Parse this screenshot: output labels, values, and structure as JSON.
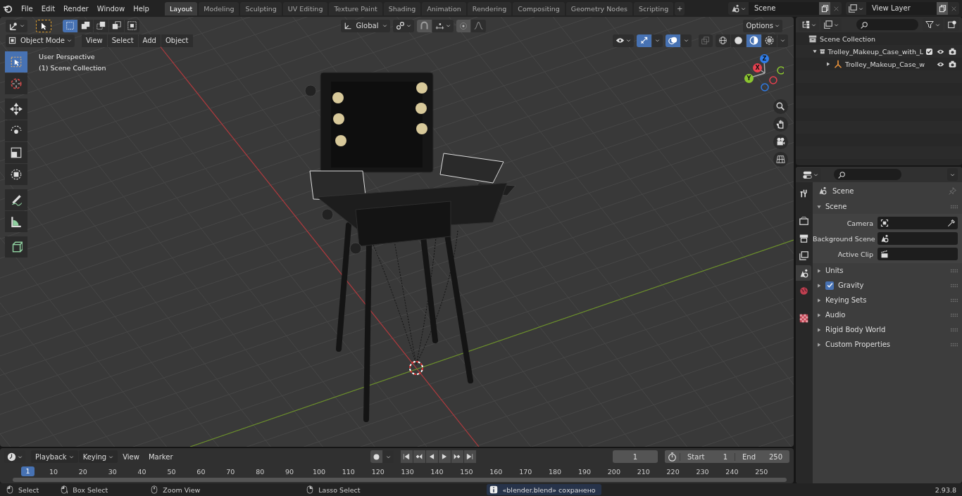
{
  "top_bar": {
    "menus": [
      "File",
      "Edit",
      "Render",
      "Window",
      "Help"
    ],
    "workspaces": [
      {
        "label": "Layout",
        "selected": true
      },
      {
        "label": "Modeling",
        "selected": false
      },
      {
        "label": "Sculpting",
        "selected": false
      },
      {
        "label": "UV Editing",
        "selected": false
      },
      {
        "label": "Texture Paint",
        "selected": false
      },
      {
        "label": "Shading",
        "selected": false
      },
      {
        "label": "Animation",
        "selected": false
      },
      {
        "label": "Rendering",
        "selected": false
      },
      {
        "label": "Compositing",
        "selected": false
      },
      {
        "label": "Geometry Nodes",
        "selected": false
      },
      {
        "label": "Scripting",
        "selected": false
      }
    ],
    "add_tab": "+",
    "scene": "Scene",
    "view_layer": "View Layer"
  },
  "viewport": {
    "select_modes": [
      {
        "kind": "set",
        "selected": true
      },
      {
        "kind": "extend",
        "selected": false
      },
      {
        "kind": "subtract",
        "selected": false
      },
      {
        "kind": "invert",
        "selected": false
      },
      {
        "kind": "intersect",
        "selected": false
      }
    ],
    "orientation": "Global",
    "options": "Options",
    "mode": "Object Mode",
    "menus": [
      "View",
      "Select",
      "Add",
      "Object"
    ],
    "gizmos_on": true,
    "overlays_on": true,
    "shading": [
      {
        "kind": "wireframe",
        "selected": false
      },
      {
        "kind": "solid",
        "selected": false
      },
      {
        "kind": "material",
        "selected": true
      },
      {
        "kind": "rendered",
        "selected": false
      }
    ],
    "overlay_text": [
      "User Perspective",
      "(1) Scene Collection"
    ],
    "axes": [
      {
        "kind": "z",
        "label": "Z"
      },
      {
        "kind": "x",
        "label": "X"
      },
      {
        "kind": "y",
        "label": "Y"
      }
    ],
    "tools": [
      {
        "kind": "select",
        "selected": true
      },
      {
        "kind": "cursor",
        "selected": false
      },
      {
        "kind": "move",
        "selected": false
      },
      {
        "kind": "rotate",
        "selected": false
      },
      {
        "kind": "scale",
        "selected": false
      },
      {
        "kind": "transform",
        "selected": false
      },
      {
        "kind": "annotate",
        "selected": false
      },
      {
        "kind": "measure",
        "selected": false
      },
      {
        "kind": "add",
        "selected": false
      }
    ]
  },
  "outliner": {
    "root": "Scene Collection",
    "items": [
      {
        "label": "Trolley_Makeup_Case_with_L",
        "kind": "collection",
        "expanded": true,
        "checked": true,
        "children": [
          {
            "label": "Trolley_Makeup_Case_w",
            "kind": "empty",
            "expanded": false
          }
        ]
      }
    ]
  },
  "properties": {
    "tabs": [
      {
        "kind": "tool",
        "selected": false
      },
      {
        "kind": "render",
        "selected": false
      },
      {
        "kind": "output",
        "selected": false
      },
      {
        "kind": "view_layer",
        "selected": false
      },
      {
        "kind": "scene",
        "selected": true
      },
      {
        "kind": "world",
        "selected": false
      },
      {
        "kind": "texture",
        "selected": false
      }
    ],
    "context": "Scene",
    "panels": [
      {
        "label": "Scene",
        "expanded": true,
        "fields": [
          {
            "label": "Camera",
            "kind": "camera"
          },
          {
            "label": "Background Scene",
            "kind": "scene"
          },
          {
            "label": "Active Clip",
            "kind": "clip"
          }
        ]
      },
      {
        "label": "Units",
        "expanded": false
      },
      {
        "label": "Gravity",
        "expanded": false,
        "checked": true
      },
      {
        "label": "Keying Sets",
        "expanded": false
      },
      {
        "label": "Audio",
        "expanded": false
      },
      {
        "label": "Rigid Body World",
        "expanded": false
      },
      {
        "label": "Custom Properties",
        "expanded": false
      }
    ]
  },
  "timeline": {
    "menus": [
      {
        "label": "Playback",
        "dropdown": true
      },
      {
        "label": "Keying",
        "dropdown": true
      },
      {
        "label": "View",
        "dropdown": false
      },
      {
        "label": "Marker",
        "dropdown": false
      }
    ],
    "current_frame": "1",
    "start_label": "Start",
    "start": "1",
    "end_label": "End",
    "end": "250",
    "ruler_current": "1",
    "ruler": [
      "10",
      "20",
      "30",
      "40",
      "50",
      "60",
      "70",
      "80",
      "90",
      "100",
      "110",
      "120",
      "130",
      "140",
      "150",
      "160",
      "170",
      "180",
      "190",
      "200",
      "210",
      "220",
      "230",
      "240",
      "250"
    ]
  },
  "status_bar": {
    "hints": [
      {
        "kind": "left",
        "label": "Select"
      },
      {
        "kind": "left_drag",
        "label": "Box Select"
      },
      {
        "kind": "middle",
        "label": "Zoom View"
      },
      {
        "kind": "right_drag",
        "label": "Lasso Select"
      }
    ],
    "message": "«blender.blend» сохранено",
    "version": "2.93.8"
  }
}
